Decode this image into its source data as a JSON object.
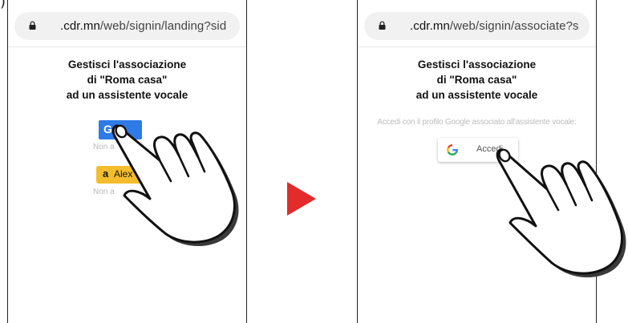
{
  "corner_mark": ")",
  "left_screen": {
    "url_domain": ".cdr.mn",
    "url_path": "/web/signin/landing?sid",
    "heading_lines": [
      "Gestisci l'associazione",
      "di \"Roma  casa\"",
      "ad un assistente vocale"
    ],
    "google_button_letter": "G",
    "google_note": "Non a",
    "alexa_button_letter": "a",
    "alexa_button_label": "Alex",
    "alexa_note": "Non a"
  },
  "right_screen": {
    "url_domain": ".cdr.mn",
    "url_path": "/web/signin/associate?s",
    "heading_lines": [
      "Gestisci l'associazione",
      "di \"Roma  casa\"",
      "ad un assistente vocale"
    ],
    "instruction": "Accedi con il profilo Google associato all'assistente vocale:",
    "signin_button_label": "Accedi"
  },
  "colors": {
    "google_blue": "#2e7ae6",
    "alexa_yellow": "#f3bd2d",
    "arrow_red": "#e32b2b"
  },
  "icons": [
    "lock-icon",
    "google-logo-icon",
    "amazon-logo-icon",
    "pointing-hand-icon",
    "arrow-right-icon"
  ]
}
